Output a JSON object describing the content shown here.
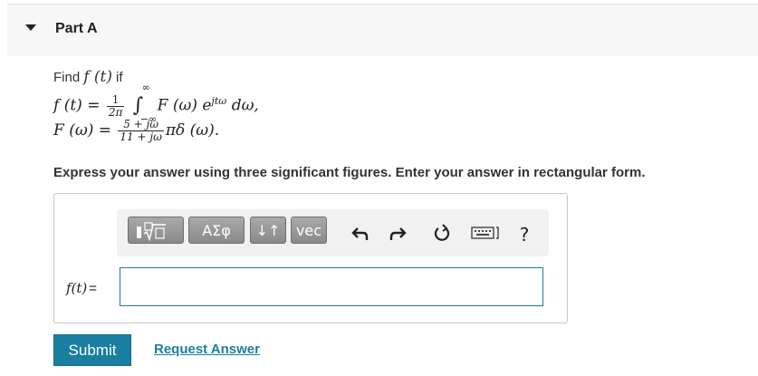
{
  "part": {
    "title": "Part A"
  },
  "question": {
    "find_prefix": "Find",
    "find_math": "f (t)",
    "find_suffix": "if",
    "eq1": {
      "lhs": "f (t) =",
      "frac_num": "1",
      "frac_den": "2π",
      "int_upper": "∞",
      "int_lower": "−∞",
      "integrand": "F (ω) e",
      "exponent": "jtω",
      "differential": "dω,"
    },
    "eq2": {
      "lhs": "F (ω) =",
      "frac_num": "5 + jω",
      "frac_den": "11 + jω",
      "rest": "πδ (ω)."
    }
  },
  "instructions": "Express your answer using three significant figures. Enter your answer in rectangular form.",
  "toolbar": {
    "templates_icon": "sqrt-template-icon",
    "greek_label": "ΑΣφ",
    "arrows_label": "↓↑",
    "vec_label": "vec",
    "undo_icon": "undo-icon",
    "redo_icon": "redo-icon",
    "reset_icon": "reset-icon",
    "keyboard_icon": "keyboard-icon",
    "help_label": "?"
  },
  "answer": {
    "label": "f(t)",
    "equals": "=",
    "value": ""
  },
  "buttons": {
    "submit": "Submit",
    "request_answer": "Request Answer"
  },
  "colors": {
    "accent": "#1a7fa0",
    "toolbar_button": "#999999"
  }
}
